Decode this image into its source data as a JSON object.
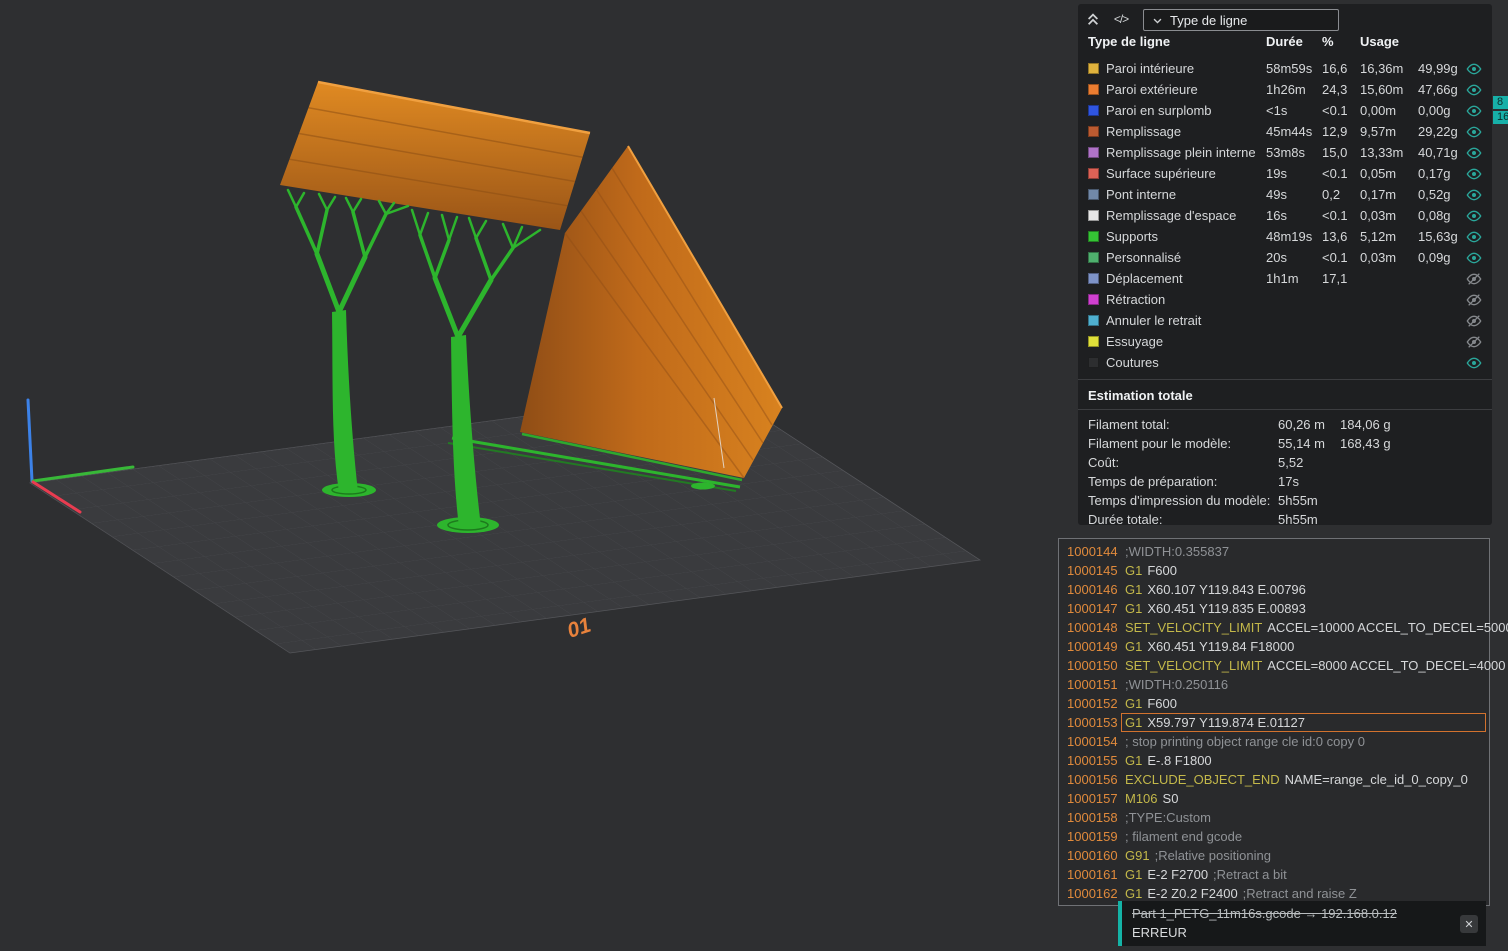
{
  "colors": {
    "accent_teal": "#14b3a6",
    "highlight_orange": "#d2722e",
    "model_orange": "#c06a1a",
    "support_green": "#2db52d"
  },
  "viewport": {
    "plate_label": "01",
    "layer_badges": [
      "8",
      "16"
    ]
  },
  "right_panel": {
    "toolbar": {
      "code_icon": "</>",
      "dropdown_label": "Type de ligne"
    },
    "table": {
      "headers": {
        "type": "Type de ligne",
        "duration": "Durée",
        "percent": "%",
        "usage": "Usage"
      },
      "rows": [
        {
          "color": "#dfb23d",
          "label": "Paroi intérieure",
          "duration": "58m59s",
          "percent": "16,6",
          "meters": "16,36m",
          "grams": "49,99g",
          "visible": true
        },
        {
          "color": "#eb7d31",
          "label": "Paroi extérieure",
          "duration": "1h26m",
          "percent": "24,3",
          "meters": "15,60m",
          "grams": "47,66g",
          "visible": true
        },
        {
          "color": "#2f55e0",
          "label": "Paroi en surplomb",
          "duration": "<1s",
          "percent": "<0.1",
          "meters": "0,00m",
          "grams": "0,00g",
          "visible": true
        },
        {
          "color": "#bc5b31",
          "label": "Remplissage",
          "duration": "45m44s",
          "percent": "12,9",
          "meters": "9,57m",
          "grams": "29,22g",
          "visible": true
        },
        {
          "color": "#b073c8",
          "label": "Remplissage plein interne",
          "duration": "53m8s",
          "percent": "15,0",
          "meters": "13,33m",
          "grams": "40,71g",
          "visible": true
        },
        {
          "color": "#dd6256",
          "label": "Surface supérieure",
          "duration": "19s",
          "percent": "<0.1",
          "meters": "0,05m",
          "grams": "0,17g",
          "visible": true
        },
        {
          "color": "#7188a8",
          "label": "Pont interne",
          "duration": "49s",
          "percent": "0,2",
          "meters": "0,17m",
          "grams": "0,52g",
          "visible": true
        },
        {
          "color": "#e6e6e6",
          "label": "Remplissage d'espace",
          "duration": "16s",
          "percent": "<0.1",
          "meters": "0,03m",
          "grams": "0,08g",
          "visible": true
        },
        {
          "color": "#35c435",
          "label": "Supports",
          "duration": "48m19s",
          "percent": "13,6",
          "meters": "5,12m",
          "grams": "15,63g",
          "visible": true
        },
        {
          "color": "#4fb06e",
          "label": "Personnalisé",
          "duration": "20s",
          "percent": "<0.1",
          "meters": "0,03m",
          "grams": "0,09g",
          "visible": true
        },
        {
          "color": "#7e93c8",
          "label": "Déplacement",
          "duration": "1h1m",
          "percent": "17,1",
          "meters": "",
          "grams": "",
          "visible": false
        },
        {
          "color": "#d040d0",
          "label": "Rétraction",
          "duration": "",
          "percent": "",
          "meters": "",
          "grams": "",
          "visible": false
        },
        {
          "color": "#4fb0d0",
          "label": "Annuler le retrait",
          "duration": "",
          "percent": "",
          "meters": "",
          "grams": "",
          "visible": false
        },
        {
          "color": "#e0e03a",
          "label": "Essuyage",
          "duration": "",
          "percent": "",
          "meters": "",
          "grams": "",
          "visible": false
        },
        {
          "color": "#2d2e30",
          "label": "Coutures",
          "duration": "",
          "percent": "",
          "meters": "",
          "grams": "",
          "visible": true
        }
      ]
    },
    "estimation": {
      "title": "Estimation totale",
      "rows": [
        {
          "label": "Filament total:",
          "v1": "60,26 m",
          "v2": "184,06 g"
        },
        {
          "label": "Filament pour le modèle:",
          "v1": "55,14 m",
          "v2": "168,43 g"
        },
        {
          "label": "Coût:",
          "v1": "5,52",
          "v2": ""
        },
        {
          "label": "Temps de préparation:",
          "v1": "17s",
          "v2": ""
        },
        {
          "label": "Temps d'impression du modèle:",
          "v1": "5h55m",
          "v2": ""
        },
        {
          "label": "Durée totale:",
          "v1": "5h55m",
          "v2": ""
        }
      ]
    }
  },
  "gcode": {
    "lines": [
      {
        "num": "1000144",
        "cmd": "",
        "text": "",
        "comment": ";WIDTH:0.355837"
      },
      {
        "num": "1000145",
        "cmd": "G1",
        "text": "F600",
        "comment": ""
      },
      {
        "num": "1000146",
        "cmd": "G1",
        "text": "X60.107 Y119.843 E.00796",
        "comment": ""
      },
      {
        "num": "1000147",
        "cmd": "G1",
        "text": "X60.451 Y119.835 E.00893",
        "comment": ""
      },
      {
        "num": "1000148",
        "cmd": "SET_VELOCITY_LIMIT",
        "text": "ACCEL=10000 ACCEL_TO_DECEL=5000",
        "comment": ""
      },
      {
        "num": "1000149",
        "cmd": "G1",
        "text": "X60.451 Y119.84 F18000",
        "comment": ""
      },
      {
        "num": "1000150",
        "cmd": "SET_VELOCITY_LIMIT",
        "text": "ACCEL=8000 ACCEL_TO_DECEL=4000",
        "comment": ""
      },
      {
        "num": "1000151",
        "cmd": "",
        "text": "",
        "comment": ";WIDTH:0.250116"
      },
      {
        "num": "1000152",
        "cmd": "G1",
        "text": "F600",
        "comment": ""
      },
      {
        "num": "1000153",
        "cmd": "G1",
        "text": "X59.797 Y119.874 E.01127",
        "comment": "",
        "highlighted": true
      },
      {
        "num": "1000154",
        "cmd": "",
        "text": "",
        "comment": "; stop printing object range cle id:0 copy 0"
      },
      {
        "num": "1000155",
        "cmd": "G1",
        "text": "E-.8 F1800",
        "comment": ""
      },
      {
        "num": "1000156",
        "cmd": "EXCLUDE_OBJECT_END",
        "text": "NAME=range_cle_id_0_copy_0",
        "comment": ""
      },
      {
        "num": "1000157",
        "cmd": "M106",
        "text": "S0",
        "comment": ""
      },
      {
        "num": "1000158",
        "cmd": "",
        "text": "",
        "comment": ";TYPE:Custom"
      },
      {
        "num": "1000159",
        "cmd": "",
        "text": "",
        "comment": "; filament end gcode"
      },
      {
        "num": "1000160",
        "cmd": "G91",
        "text": "",
        "comment": ";Relative positioning"
      },
      {
        "num": "1000161",
        "cmd": "G1",
        "text": "E-2 F2700",
        "comment": ";Retract a bit"
      },
      {
        "num": "1000162",
        "cmd": "G1",
        "text": "E-2 Z0.2 F2400",
        "comment": ";Retract and raise Z"
      }
    ]
  },
  "notification": {
    "message": "Part 1_PETG_11m16s.gcode  →  192.168.0.12",
    "status": "ERREUR",
    "close_icon": "✕"
  }
}
